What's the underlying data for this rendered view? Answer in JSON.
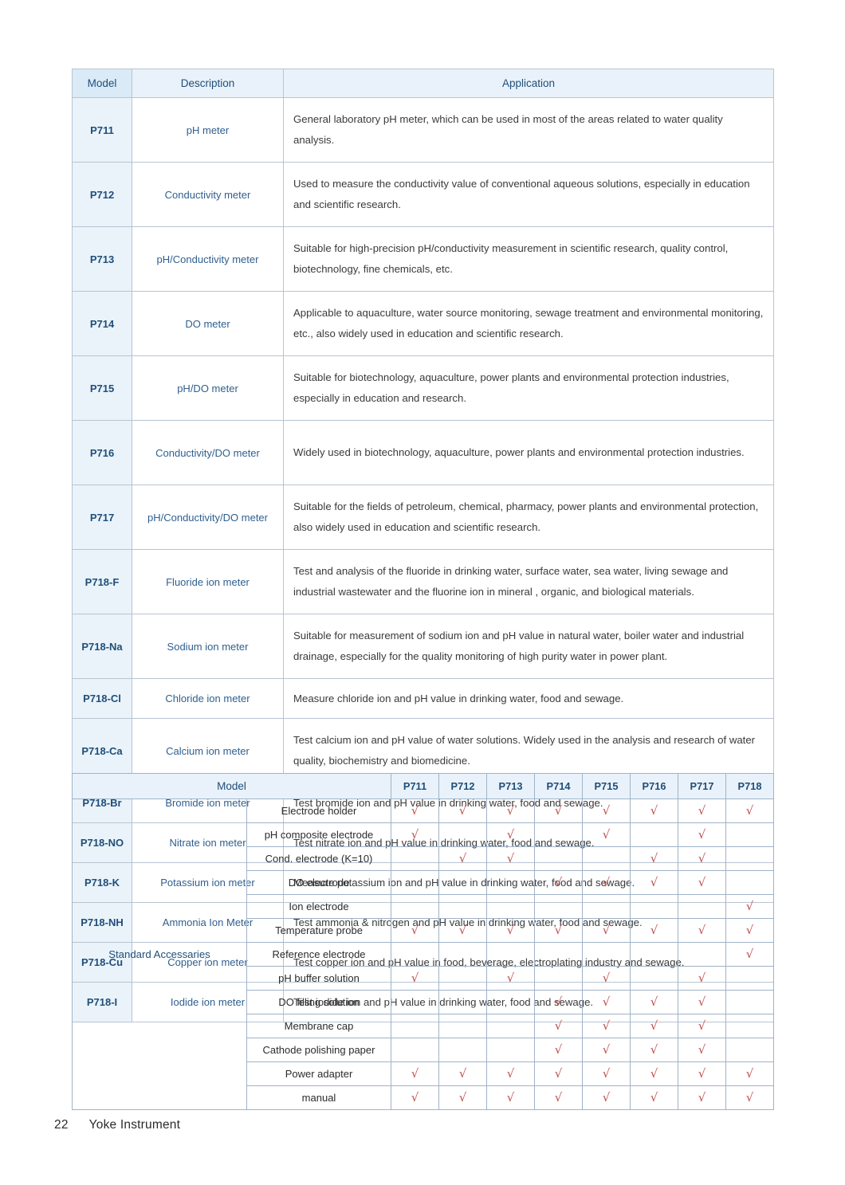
{
  "models_table": {
    "headers": [
      "Model",
      "Description",
      "Application"
    ],
    "rows": [
      {
        "model": "P711",
        "description": "pH meter",
        "application": "General laboratory pH meter, which can be used in most of the areas related to water quality analysis.",
        "lines": 2
      },
      {
        "model": "P712",
        "description": "Conductivity meter",
        "application": "Used to measure the conductivity value of conventional aqueous solutions, especially in education and scientific research.",
        "lines": 2
      },
      {
        "model": "P713",
        "description": "pH/Conductivity meter",
        "application": "Suitable for high-precision pH/conductivity measurement in scientific research, quality control, biotechnology, fine chemicals, etc.",
        "lines": 2
      },
      {
        "model": "P714",
        "description": "DO meter",
        "application": "Applicable to aquaculture, water source monitoring, sewage treatment and environmental monitoring, etc., also widely used in education and scientific research.",
        "lines": 2
      },
      {
        "model": "P715",
        "description": "pH/DO meter",
        "application": "Suitable for biotechnology, aquaculture, power plants and environmental protection industries, especially in education and research.",
        "lines": 2
      },
      {
        "model": "P716",
        "description": "Conductivity/DO meter",
        "application": "Widely used in biotechnology, aquaculture, power plants and environmental protection  industries.",
        "lines": 2
      },
      {
        "model": "P717",
        "description": "pH/Conductivity/DO meter",
        "application": "Suitable for the fields of petroleum, chemical, pharmacy, power plants and environmental protection, also widely used in education and scientific research.",
        "lines": 2
      },
      {
        "model": "P718-F",
        "description": "Fluoride ion meter",
        "application": "Test and analysis of the fluoride in drinking water, surface water, sea water, living sewage and industrial wastewater and the fluorine ion in mineral , organic, and biological materials.",
        "lines": 2
      },
      {
        "model": "P718-Na",
        "description": "Sodium ion meter",
        "application": "Suitable for measurement of sodium ion and pH value in natural water, boiler water and industrial drainage, especially for the quality monitoring of high purity water in power plant.",
        "lines": 2
      },
      {
        "model": "P718-Cl",
        "description": "Chloride ion meter",
        "application": "Measure chloride ion and pH value in drinking water, food and sewage.",
        "lines": 1
      },
      {
        "model": "P718-Ca",
        "description": "Calcium ion meter",
        "application": "Test calcium ion and pH value of water solutions. Widely used in the analysis and research of water quality, biochemistry and biomedicine.",
        "lines": 2
      },
      {
        "model": "P718-Br",
        "description": "Bromide ion meter",
        "application": "Test bromide ion and pH value in drinking water, food and sewage.",
        "lines": 1
      },
      {
        "model": "P718-NO",
        "description": "Nitrate ion meter",
        "application": "Test nitrate ion and pH value in drinking water, food and sewage.",
        "lines": 1
      },
      {
        "model": "P718-K",
        "description": "Potassium ion meter",
        "application": "Measure potassium ion and pH value in drinking water, food and sewage.",
        "lines": 1
      },
      {
        "model": "P718-NH",
        "description": "Ammonia Ion Meter",
        "application": "Test ammonia & nitrogen and pH value in drinking water, food and sewage.",
        "lines": 1
      },
      {
        "model": "P718-Cu",
        "description": "Copper ion meter",
        "application": "Test copper ion and pH value in food, beverage, electroplating industry and sewage.",
        "lines": 1
      },
      {
        "model": "P718-I",
        "description": "Iodide ion meter",
        "application": "Test iodide ion and pH value in drinking water, food and sewage.",
        "lines": 1
      }
    ]
  },
  "accessories_table": {
    "header_model": "Model",
    "column_models": [
      "P711",
      "P712",
      "P713",
      "P714",
      "P715",
      "P716",
      "P717",
      "P718"
    ],
    "group_label": "Standard Accessaries",
    "check_glyph": "√",
    "check_color": "#c0504d",
    "rows": [
      {
        "item": "Electrode holder",
        "checks": [
          true,
          true,
          true,
          true,
          true,
          true,
          true,
          true
        ]
      },
      {
        "item": "pH composite electrode",
        "checks": [
          true,
          false,
          true,
          false,
          true,
          false,
          true,
          false
        ]
      },
      {
        "item": "Cond. electrode (K=10)",
        "checks": [
          false,
          true,
          true,
          false,
          false,
          true,
          true,
          false
        ]
      },
      {
        "item": "DO electrode",
        "checks": [
          false,
          false,
          false,
          true,
          true,
          true,
          true,
          false
        ]
      },
      {
        "item": "Ion electrode",
        "checks": [
          false,
          false,
          false,
          false,
          false,
          false,
          false,
          true
        ]
      },
      {
        "item": "Temperature probe",
        "checks": [
          true,
          true,
          true,
          true,
          true,
          true,
          true,
          true
        ]
      },
      {
        "item": "Reference electrode",
        "checks": [
          false,
          false,
          false,
          false,
          false,
          false,
          false,
          true
        ]
      },
      {
        "item": "pH buffer solution",
        "checks": [
          true,
          false,
          true,
          false,
          true,
          false,
          true,
          false
        ]
      },
      {
        "item": "DO filling solution",
        "checks": [
          false,
          false,
          false,
          true,
          true,
          true,
          true,
          false
        ]
      },
      {
        "item": "Membrane cap",
        "checks": [
          false,
          false,
          false,
          true,
          true,
          true,
          true,
          false
        ]
      },
      {
        "item": "Cathode polishing paper",
        "checks": [
          false,
          false,
          false,
          true,
          true,
          true,
          true,
          false
        ]
      },
      {
        "item": "Power adapter",
        "checks": [
          true,
          true,
          true,
          true,
          true,
          true,
          true,
          true
        ]
      },
      {
        "item": "manual",
        "checks": [
          true,
          true,
          true,
          true,
          true,
          true,
          true,
          true
        ]
      }
    ]
  },
  "footer": {
    "page_number": "22",
    "company": "Yoke Instrument"
  },
  "colors": {
    "header_blue_bg": "#e9f2fa",
    "model_cell_bg": "#eaf3fa",
    "text_blue": "#1f4e79",
    "desc_blue": "#2f5f8f",
    "border": "#b8c4d2",
    "check_red": "#c0504d"
  }
}
